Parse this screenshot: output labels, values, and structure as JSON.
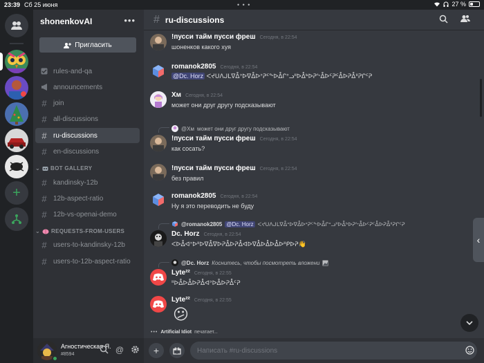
{
  "status_bar": {
    "time": "23:39",
    "date": "Сб 25 июня",
    "battery": "27 %",
    "battery_level": 0.27
  },
  "colors": {
    "background": "#36393f",
    "sidebar": "#2f3136",
    "rail": "#202225",
    "accent": "#5865f2",
    "online": "#3ba55d"
  },
  "rail": {
    "servers": [
      {
        "name": "home",
        "icon": "discord-home-icon"
      },
      {
        "name": "owl-server",
        "icon": "owl-art-icon"
      },
      {
        "name": "server-2",
        "icon": "server-avatar-icon"
      },
      {
        "name": "server-3",
        "icon": "christmas-tree-icon"
      },
      {
        "name": "server-4",
        "icon": "car-icon"
      },
      {
        "name": "server-5",
        "icon": "bug-icon"
      }
    ],
    "add_server_icon": "plus-icon",
    "explore_icon": "explore-hubs-icon"
  },
  "guild": {
    "name": "shonenkovAI",
    "more_icon": "ellipsis-icon",
    "invite_label": "Пригласить",
    "invite_icon": "add-user-icon"
  },
  "channels": [
    {
      "name": "rules-and-qa",
      "icon": "rules-checkbox-icon"
    },
    {
      "name": "announcements",
      "icon": "megaphone-icon"
    },
    {
      "name": "join",
      "icon": "hash-icon"
    },
    {
      "name": "all-discussions",
      "icon": "hash-icon"
    },
    {
      "name": "ru-discussions",
      "icon": "hash-icon",
      "active": true
    },
    {
      "name": "en-discussions",
      "icon": "hash-icon"
    }
  ],
  "categories": [
    {
      "name": "BOT GALLERY",
      "channels": [
        "kandinsky-12b",
        "12b-aspect-ratio",
        "12b-vs-openai-demo"
      ]
    },
    {
      "name": "REQUESTS-FROM-USERS",
      "channels": [
        "users-to-kandinsky-12b",
        "users-to-12b-aspect-ratio"
      ]
    }
  ],
  "user": {
    "name": "Агностическая Я...",
    "tag": "#8594"
  },
  "channel_header": {
    "title": "ru-discussions",
    "search_icon": "search-icon",
    "members_icon": "members-icon"
  },
  "messages": [
    {
      "author": "!пусси тайм пусси фреш",
      "time": "Сегодня, в 22:54",
      "text": "шоненков какого хуя"
    },
    {
      "author": "romanok2805",
      "time": "Сегодня, в 22:54",
      "mention": "@Dc. Horz",
      "text": "ᐸᔪᑌᐱᒍᒪᐁᐂᐣᐅᐁᐂᐅᐣᕈᑦᖕᐅᐂᒋᐣᓗᐦᐅᐂᒃᐅᕈᖦᐂᐅᑦᕈᑦᐂᐅᕈᐂᐦᕈᒋᑦᕈ"
    },
    {
      "author": "Хм",
      "time": "Сегодня, в 22:54",
      "text": "может они друг другу подсказывают"
    },
    {
      "reply_author": "@Хм",
      "reply_text": "может они друг другу подсказывают",
      "author": "!пусси тайм пусси фреш",
      "time": "Сегодня, в 22:54",
      "text": "как сосать?"
    },
    {
      "author": "!пусси тайм пусси фреш",
      "time": "Сегодня, в 22:54",
      "text": "без правил"
    },
    {
      "author": "romanok2805",
      "time": "Сегодня, в 22:54",
      "text": "Ну я это переводить не буду"
    },
    {
      "reply_author": "@romanok2805",
      "reply_mention": "@Dc. Horz",
      "reply_text": "ᐸᔪᑌᐱᒍᒪᐁᐂᐣᐅᐁᐂᐅᐣᕈᑦᖕᐅᐂᒋᐣᓗᐦᐅᐂᒃᐅᕈᖦᐂᐅᑦᕈᑦᐂᐅᕈᐂᐦᕈᒋᑦᕈ",
      "author": "Dc. Horz",
      "time": "Сегодня, в 22:54",
      "text": "ᐸᐅᐂᐊᐣᐅᐦᐅᐁᐂᐁᐅᕈᐂᐅᕈᐂᐊᐅᐁᐂᐅᐂᐅᐂᐅᐦᑭᐅᕈ👋"
    },
    {
      "reply_author": "@Dc. Horz",
      "reply_text": "Коснитесь, чтобы посмотреть вложени",
      "author": "Lyte²²",
      "time": "Сегодня, в 22:55",
      "text": "ᐦᐅᐂᐅᐂᐅᕈᐂᐊᐣᐅᐂᐅᕈᐂᑦᕈ"
    },
    {
      "author": "Lyte²²",
      "time": "Сегодня, в 22:55",
      "text": "😕"
    }
  ],
  "typing": {
    "user": "Artificial Idiot",
    "suffix": "печатает..."
  },
  "composer": {
    "placeholder": "Написать #ru-discussions",
    "add_icon": "plus-icon",
    "gift_icon": "gift-icon",
    "emoji_icon": "emoji-icon"
  }
}
